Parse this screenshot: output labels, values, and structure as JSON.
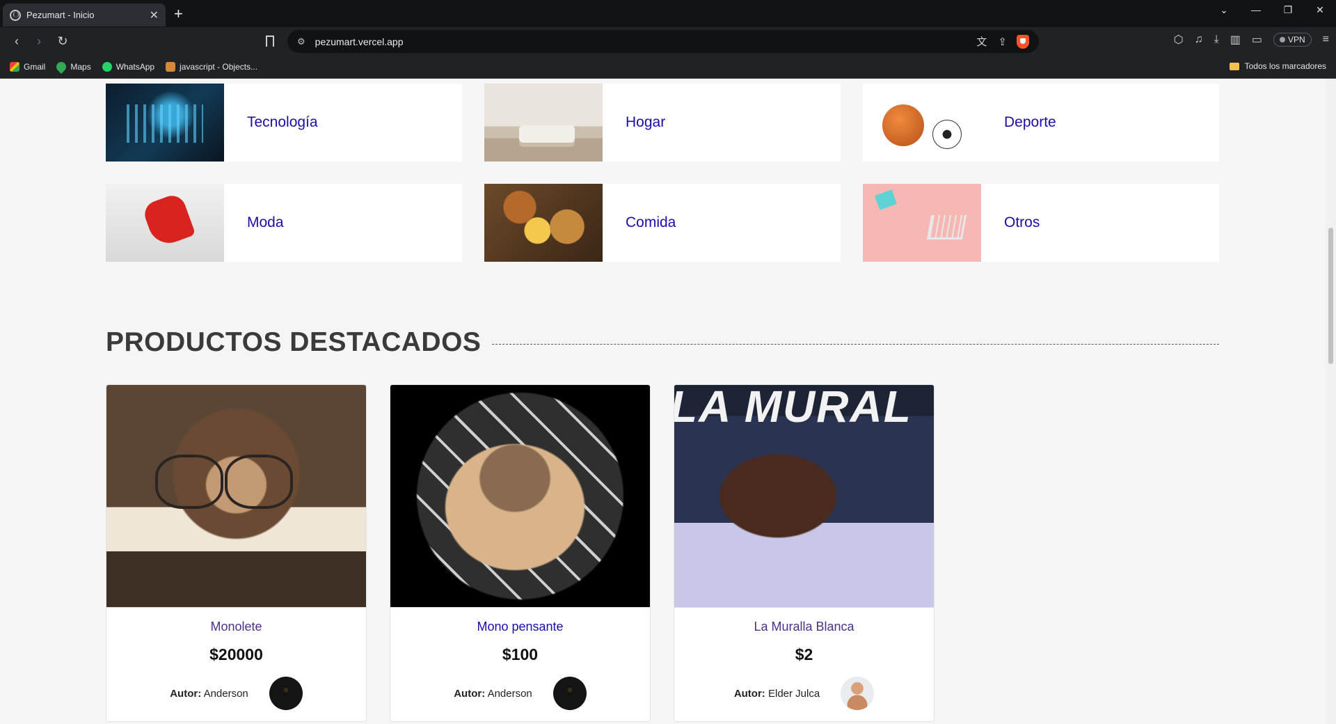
{
  "browser": {
    "tab_title": "Pezumart - Inicio",
    "url": "pezumart.vercel.app",
    "vpn_label": "VPN",
    "bookmarks": [
      {
        "label": "Gmail"
      },
      {
        "label": "Maps"
      },
      {
        "label": "WhatsApp"
      },
      {
        "label": "javascript - Objects..."
      }
    ],
    "bookmarks_folder": "Todos los marcadores"
  },
  "categories": [
    {
      "label": "Tecnología"
    },
    {
      "label": "Hogar"
    },
    {
      "label": "Deporte"
    },
    {
      "label": "Moda"
    },
    {
      "label": "Comida"
    },
    {
      "label": "Otros"
    }
  ],
  "featured": {
    "title": "PRODUCTOS DESTACADOS",
    "author_prefix": "Autor:",
    "products": [
      {
        "name": "Monolete",
        "price": "$20000",
        "author": "Anderson"
      },
      {
        "name": "Mono pensante",
        "price": "$100",
        "author": "Anderson"
      },
      {
        "name": "La Muralla Blanca",
        "price": "$2",
        "author": "Elder Julca",
        "image_text": "LA MURAL"
      }
    ]
  },
  "colors": {
    "link": "#1a0dab",
    "visited": "#4b2f8a",
    "brave": "#fb542b"
  }
}
